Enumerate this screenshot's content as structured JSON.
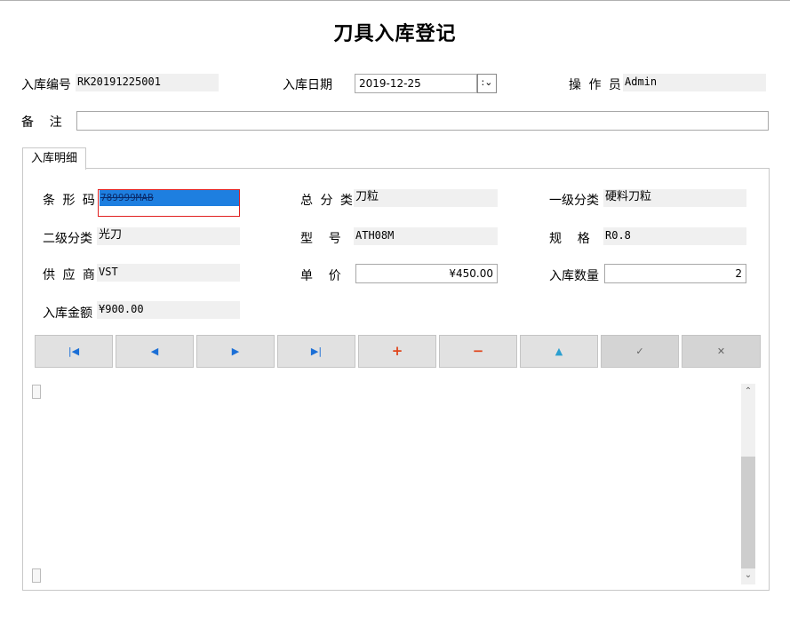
{
  "title": "刀具入库登记",
  "header": {
    "no_label": "入库编号",
    "no_value": "RK20191225001",
    "date_label": "入库日期",
    "date_value": "2019-12-25",
    "date_drop": ":",
    "operator_label": "操 作 员",
    "operator_value": "Admin",
    "remark_label": "备    注",
    "remark_value": ""
  },
  "tab": {
    "label": "入库明细"
  },
  "detail": {
    "barcode_label": "条 形 码",
    "barcode_value": "789999MAB",
    "category_label": "总 分 类",
    "category_value": "刀粒",
    "level1_label": "一级分类",
    "level1_value": "硬料刀粒",
    "level2_label": "二级分类",
    "level2_value": "光刀",
    "model_label": "型    号",
    "model_value": "ATH08M",
    "spec_label": "规    格",
    "spec_value": "R0.8",
    "supplier_label": "供 应 商",
    "supplier_value": "VST",
    "price_label": "单    价",
    "price_value": "¥450.00",
    "qty_label": "入库数量",
    "qty_value": "2",
    "amount_label": "入库金额",
    "amount_value": "¥900.00"
  },
  "navigator": {
    "first": "|◀",
    "prior": "◀",
    "next": "▶",
    "last": "▶|",
    "insert": "+",
    "delete": "−",
    "edit": "▲",
    "post": "✓",
    "cancel": "✕"
  },
  "colors": {
    "selection": "#1e7fe0",
    "focus_border": "#e02020",
    "nav_blue": "#1b6fd6",
    "nav_red": "#e0451b",
    "nav_teal": "#2b9fd0"
  }
}
